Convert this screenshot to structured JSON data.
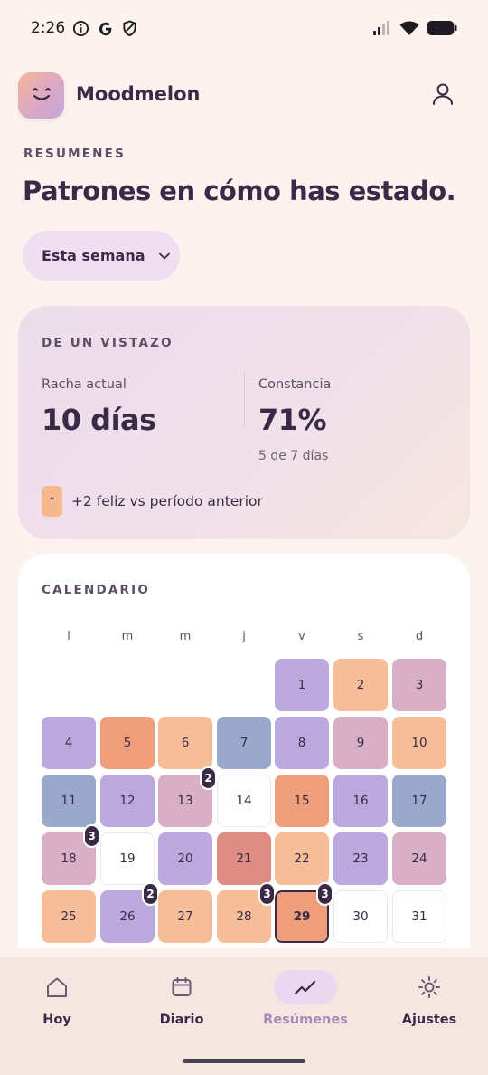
{
  "status_bar": {
    "time": "2:26",
    "icons_left": [
      "info-icon",
      "google-icon",
      "shield-icon"
    ],
    "icons_right": [
      "signal-icon",
      "wifi-icon",
      "battery-icon"
    ]
  },
  "header": {
    "app_name": "Moodmelon",
    "logo_icon": "smile-icon",
    "profile_icon": "user-icon"
  },
  "summary": {
    "section_label": "RESÚMENES",
    "title": "Patrones en cómo has estado.",
    "period_selected": "Esta semana"
  },
  "glance": {
    "title": "DE UN VISTAZO",
    "streak_label": "Racha actual",
    "streak_value": "10 días",
    "consistency_label": "Constancia",
    "consistency_value": "71%",
    "consistency_sub": "5 de 7 días",
    "trend_arrow": "↑",
    "trend_text": "+2 feliz vs período anterior"
  },
  "calendar": {
    "title": "CALENDARIO",
    "weekdays": [
      "l",
      "m",
      "m",
      "j",
      "v",
      "s",
      "d"
    ],
    "colors": {
      "purple": "#bba8dd",
      "peach": "#f5be98",
      "pink": "#d9afc6",
      "orange": "#ef9e7c",
      "blue": "#9aa8cc",
      "red": "#de8c84"
    },
    "days": [
      {
        "label": "1",
        "color": "#bba8dd"
      },
      {
        "label": "2",
        "color": "#f5be98"
      },
      {
        "label": "3",
        "color": "#d9afc6"
      },
      {
        "label": "4",
        "color": "#bba8dd"
      },
      {
        "label": "5",
        "color": "#ef9e7c"
      },
      {
        "label": "6",
        "color": "#f5be98"
      },
      {
        "label": "7",
        "color": "#9aa8cc"
      },
      {
        "label": "8",
        "color": "#bba8dd"
      },
      {
        "label": "9",
        "color": "#d9afc6"
      },
      {
        "label": "10",
        "color": "#f5be98"
      },
      {
        "label": "11",
        "color": "#9aa8cc"
      },
      {
        "label": "12",
        "color": "#bba8dd"
      },
      {
        "label": "13",
        "color": "#d9afc6",
        "badge": "2"
      },
      {
        "label": "14",
        "color": ""
      },
      {
        "label": "15",
        "color": "#ef9e7c"
      },
      {
        "label": "16",
        "color": "#bba8dd"
      },
      {
        "label": "17",
        "color": "#9aa8cc"
      },
      {
        "label": "18",
        "color": "#d9afc6",
        "badge": "3"
      },
      {
        "label": "19",
        "color": ""
      },
      {
        "label": "20",
        "color": "#bba8dd"
      },
      {
        "label": "21",
        "color": "#de8c84"
      },
      {
        "label": "22",
        "color": "#f5be98"
      },
      {
        "label": "23",
        "color": "#bba8dd"
      },
      {
        "label": "24",
        "color": "#d9afc6"
      },
      {
        "label": "25",
        "color": "#f5be98"
      },
      {
        "label": "26",
        "color": "#bba8dd",
        "badge": "2"
      },
      {
        "label": "27",
        "color": "#f5be98"
      },
      {
        "label": "28",
        "color": "#f5be98",
        "badge": "3"
      },
      {
        "label": "29",
        "color": "#ef9e7c",
        "badge": "3",
        "today": true
      },
      {
        "label": "30",
        "color": ""
      },
      {
        "label": "31",
        "color": ""
      }
    ]
  },
  "nav": {
    "items": [
      {
        "label": "Hoy",
        "icon": "home-icon"
      },
      {
        "label": "Diario",
        "icon": "calendar-icon"
      },
      {
        "label": "Resúmenes",
        "icon": "trend-icon",
        "active": true
      },
      {
        "label": "Ajustes",
        "icon": "sun-icon"
      }
    ]
  }
}
